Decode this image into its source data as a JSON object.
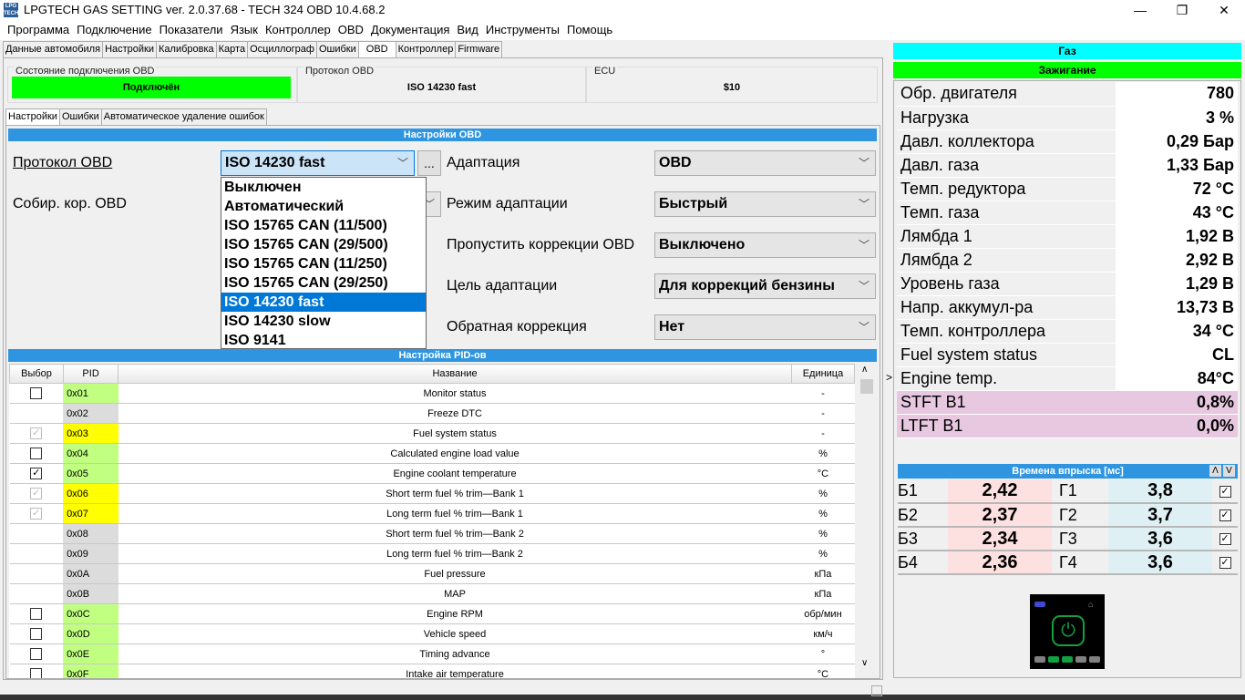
{
  "window": {
    "title": "LPGTECH GAS SETTING ver. 2.0.37.68  -  TECH 324 OBD   10.4.68.2",
    "logo": "LPG TECH",
    "minimize": "—",
    "maximize": "❐",
    "close": "✕"
  },
  "menu": [
    "Программа",
    "Подключение",
    "Показатели",
    "Язык",
    "Контроллер",
    "OBD",
    "Документация",
    "Вид",
    "Инструменты",
    "Помощь"
  ],
  "tabs": [
    "Данные автомобиля",
    "Настройки",
    "Калибровка",
    "Карта",
    "Осциллограф",
    "Ошибки",
    "OBD",
    "Контроллер",
    "Firmware"
  ],
  "active_tab": "OBD",
  "status": {
    "conn_label": "Состояние подключения OBD",
    "conn_value": "Подключён",
    "conn_color": "#00ff00",
    "proto_label": "Протокол OBD",
    "proto_value": "ISO 14230 fast",
    "ecu_label": "ECU",
    "ecu_value": "$10"
  },
  "subtabs": [
    "Настройки",
    "Ошибки",
    "Автоматическое удаление ошибок"
  ],
  "settings": {
    "header": "Настройки OBD",
    "protocol_label": "Протокол OBD",
    "protocol_value": "ISO 14230 fast",
    "more_button": "...",
    "collect_label": "Собир. кор. OBD",
    "dropdown_options": [
      "Выключен",
      "Автоматический",
      "ISO 15765 CAN (11/500)",
      "ISO 15765 CAN (29/500)",
      "ISO 15765 CAN (11/250)",
      "ISO 15765 CAN (29/250)",
      "ISO 14230 fast",
      "ISO 14230 slow",
      "ISO 9141"
    ],
    "dropdown_selected": "ISO 14230 fast",
    "right": [
      {
        "label": "Адаптация",
        "value": "OBD"
      },
      {
        "label": "Режим адаптации",
        "value": "Быстрый"
      },
      {
        "label": "Пропустить коррекции OBD",
        "value": "Выключено"
      },
      {
        "label": "Цель адаптации",
        "value": "Для коррекций бензины"
      },
      {
        "label": "Обратная коррекция",
        "value": "Нет"
      }
    ]
  },
  "pid": {
    "header": "Настройка PID-ов",
    "columns": [
      "Выбор",
      "PID",
      "Название",
      "Единица"
    ],
    "rows": [
      {
        "check": "unchecked",
        "pid": "0x01",
        "name": "Monitor status",
        "unit": "-",
        "color": "#c0ff80"
      },
      {
        "check": "none",
        "pid": "0x02",
        "name": "Freeze DTC",
        "unit": "-",
        "color": "#dcdcdc"
      },
      {
        "check": "disabled",
        "pid": "0x03",
        "name": "Fuel system status",
        "unit": "-",
        "color": "#ffff00"
      },
      {
        "check": "unchecked",
        "pid": "0x04",
        "name": "Calculated engine load value",
        "unit": "%",
        "color": "#c0ff80"
      },
      {
        "check": "checked",
        "pid": "0x05",
        "name": "Engine coolant temperature",
        "unit": "°C",
        "color": "#c0ff80"
      },
      {
        "check": "disabled",
        "pid": "0x06",
        "name": "Short term fuel % trim—Bank 1",
        "unit": "%",
        "color": "#ffff00"
      },
      {
        "check": "disabled",
        "pid": "0x07",
        "name": "Long term fuel % trim—Bank 1",
        "unit": "%",
        "color": "#ffff00"
      },
      {
        "check": "none",
        "pid": "0x08",
        "name": "Short term fuel % trim—Bank 2",
        "unit": "%",
        "color": "#dcdcdc"
      },
      {
        "check": "none",
        "pid": "0x09",
        "name": "Long term fuel % trim—Bank 2",
        "unit": "%",
        "color": "#dcdcdc"
      },
      {
        "check": "none",
        "pid": "0x0A",
        "name": "Fuel pressure",
        "unit": "кПа",
        "color": "#dcdcdc"
      },
      {
        "check": "none",
        "pid": "0x0B",
        "name": "MAP",
        "unit": "кПа",
        "color": "#dcdcdc"
      },
      {
        "check": "unchecked",
        "pid": "0x0C",
        "name": "Engine RPM",
        "unit": "обр/мин",
        "color": "#c0ff80"
      },
      {
        "check": "unchecked",
        "pid": "0x0D",
        "name": "Vehicle speed",
        "unit": "км/ч",
        "color": "#c0ff80"
      },
      {
        "check": "unchecked",
        "pid": "0x0E",
        "name": "Timing advance",
        "unit": "°",
        "color": "#c0ff80"
      },
      {
        "check": "unchecked",
        "pid": "0x0F",
        "name": "Intake air temperature",
        "unit": "°C",
        "color": "#c0ff80"
      }
    ]
  },
  "right_panel": {
    "gas": "Газ",
    "gas_color": "#00ffff",
    "ignition": "Зажигание",
    "ignition_color": "#00ff00",
    "params": [
      {
        "label": "Обр. двигателя",
        "value": "780"
      },
      {
        "label": "Нагрузка",
        "value": "3 %"
      },
      {
        "label": "Давл. коллектора",
        "value": "0,29 Бар"
      },
      {
        "label": "Давл. газа",
        "value": "1,33 Бар"
      },
      {
        "label": "Темп. редуктора",
        "value": "72 °C"
      },
      {
        "label": "Темп. газа",
        "value": "43 °C"
      },
      {
        "label": "Лямбда 1",
        "value": "1,92 В"
      },
      {
        "label": "Лямбда 2",
        "value": "2,92 В"
      },
      {
        "label": "Уровень газа",
        "value": "1,29 В"
      },
      {
        "label": "Напр. аккумул-ра",
        "value": "13,73 В"
      },
      {
        "label": "Темп. контроллера",
        "value": "34 °C"
      },
      {
        "label": "Fuel system status",
        "value": "CL"
      },
      {
        "label": "Engine temp.",
        "value": "84°C"
      },
      {
        "label": "STFT B1",
        "value": "0,8%"
      },
      {
        "label": "LTFT B1",
        "value": "0,0%"
      }
    ],
    "row_marker": ">",
    "injection": {
      "header": "Времена впрыска [мс]",
      "up": "Λ",
      "down": "V",
      "rows": [
        {
          "b": "Б1",
          "bv": "2,42",
          "g": "Г1",
          "gv": "3,8"
        },
        {
          "b": "Б2",
          "bv": "2,37",
          "g": "Г2",
          "gv": "3,7"
        },
        {
          "b": "Б3",
          "bv": "2,34",
          "g": "Г3",
          "gv": "3,6"
        },
        {
          "b": "Б4",
          "bv": "2,36",
          "g": "Г4",
          "gv": "3,6"
        }
      ]
    }
  }
}
